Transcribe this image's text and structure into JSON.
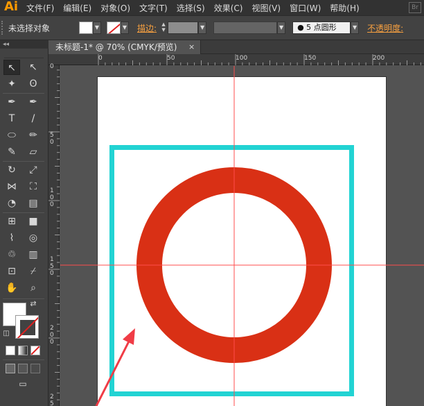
{
  "app": {
    "logo": "Ai",
    "bridge_icon": "Br"
  },
  "menubar": {
    "items": [
      "文件(F)",
      "编辑(E)",
      "对象(O)",
      "文字(T)",
      "选择(S)",
      "效果(C)",
      "视图(V)",
      "窗口(W)",
      "帮助(H)"
    ]
  },
  "controlbar": {
    "selection_label": "未选择对象",
    "stroke_label": "描边",
    "stroke_colon": ":",
    "point_label": "● 5 点圆形",
    "opacity_label": "不透明度",
    "opacity_colon": ":"
  },
  "panel": {
    "collapse": "◂◂"
  },
  "document_tab": {
    "title": "未标题-1* @ 70% (CMYK/预览)",
    "close": "×"
  },
  "rulers": {
    "horizontal": [
      "0",
      "50",
      "100",
      "150",
      "200"
    ],
    "vertical": [
      "0",
      "5\n0",
      "1\n0\n0",
      "1\n5\n0",
      "2\n0\n0",
      "2\n5"
    ]
  },
  "colors": {
    "ring": "#d93015",
    "frame": "#22d3d3",
    "guide": "#ff4c4c",
    "arrow": "#f03c46",
    "artboard": "#ffffff"
  },
  "icons": {
    "selection": "↖",
    "direct_selection": "↖",
    "magic_wand": "✦",
    "lasso": "ʘ",
    "pen": "✒",
    "curvature": "✒",
    "type": "T",
    "line": "/",
    "ellipse": "⬭",
    "paintbrush": "✏",
    "shaper": "✎",
    "eraser": "▱",
    "rotate": "↻",
    "scale": "⤢",
    "width": "⋈",
    "free_transform": "⛶",
    "shape_builder": "◔",
    "graph": "▤",
    "mesh": "⊞",
    "gradient": "■",
    "eyedropper": "⌇",
    "blend": "◎",
    "symbol": "♲",
    "column_graph": "▥",
    "artboard": "⊡",
    "slice": "⌿",
    "hand": "✋",
    "zoom": "⌕",
    "swap": "⇄",
    "default": "◫"
  }
}
